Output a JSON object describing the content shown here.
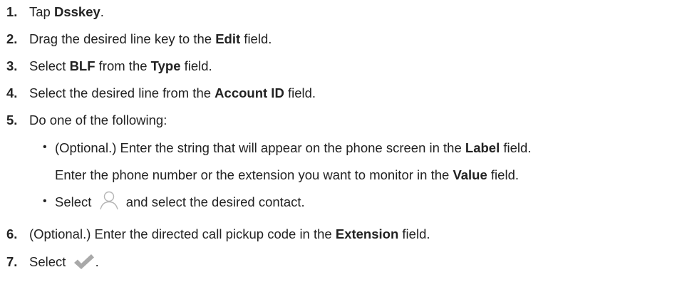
{
  "steps": [
    {
      "num": "1.",
      "pre": "Tap ",
      "b1": "Dsskey",
      "mid": ".",
      "b2": "",
      "post": ""
    },
    {
      "num": "2.",
      "pre": "Drag the desired line key to the ",
      "b1": "Edit",
      "mid": " field.",
      "b2": "",
      "post": ""
    },
    {
      "num": "3.",
      "pre": "Select ",
      "b1": "BLF",
      "mid": " from the ",
      "b2": "Type",
      "post": " field."
    },
    {
      "num": "4.",
      "pre": "Select the desired line from the ",
      "b1": "Account ID",
      "mid": " field.",
      "b2": "",
      "post": ""
    },
    {
      "num": "5.",
      "pre": "Do one of the following:",
      "b1": "",
      "mid": "",
      "b2": "",
      "post": ""
    },
    {
      "num": "6.",
      "pre": "(Optional.) Enter the directed call pickup code in the ",
      "b1": "Extension",
      "mid": " field.",
      "b2": "",
      "post": ""
    },
    {
      "num": "7.",
      "pre": "Select ",
      "b1": "",
      "mid": "",
      "b2": "",
      "post": "."
    }
  ],
  "sub_items": {
    "bullet": "•",
    "item1_line1_pre": "(Optional.) Enter the string that will appear on the phone screen in the ",
    "item1_line1_bold": "Label",
    "item1_line1_post": " field.",
    "item1_line2_pre": "Enter the phone number or the extension you want to monitor in the ",
    "item1_line2_bold": "Value",
    "item1_line2_post": " field.",
    "item2_pre": "Select ",
    "item2_post": " and select the desired contact."
  },
  "icons": {
    "contact": "contact-icon",
    "checkmark": "checkmark-icon",
    "icon_color": "#a9a9a9"
  }
}
